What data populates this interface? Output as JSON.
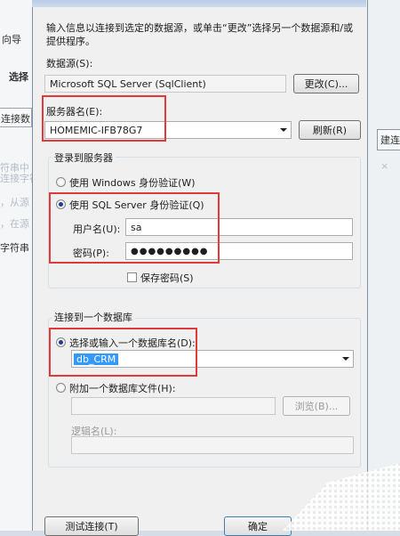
{
  "background": {
    "left_title": "向导",
    "left_select": "选择",
    "left_tab": "连接数",
    "left_hint1": "符串中",
    "left_hint2": "连接字符",
    "left_hint3": "，从源",
    "left_hint4": "，在源",
    "left_hint5": "字符串",
    "right_button": "建连"
  },
  "dialog": {
    "intro": "输入信息以连接到选定的数据源，或单击“更改”选择另一个数据源和/或提供程序。",
    "datasource_label": "数据源(S):",
    "datasource_value": "Microsoft SQL Server (SqlClient)",
    "change_button": "更改(C)...",
    "server_label": "服务器名(E):",
    "server_value": "HOMEMIC-IFB78G7",
    "refresh_button": "刷新(R)",
    "login_group": "登录到服务器",
    "windows_auth": "使用 Windows 身份验证(W)",
    "sql_auth": "使用 SQL Server 身份验证(Q)",
    "username_label": "用户名(U):",
    "username_value": "sa",
    "password_label": "密码(P):",
    "password_value": "●●●●●●●●●",
    "save_password": "保存密码(S)",
    "connect_db_group": "连接到一个数据库",
    "select_db": "选择或输入一个数据库名(D):",
    "db_value": "db_CRM",
    "attach_db": "附加一个数据库文件(H):",
    "browse_button": "浏览(B)...",
    "logical_name_label": "逻辑名(L):",
    "test_button": "测试连接(T)",
    "ok_button": "确定"
  },
  "colors": {
    "highlight_box": "#e23a3a",
    "selection": "#3399ff"
  }
}
